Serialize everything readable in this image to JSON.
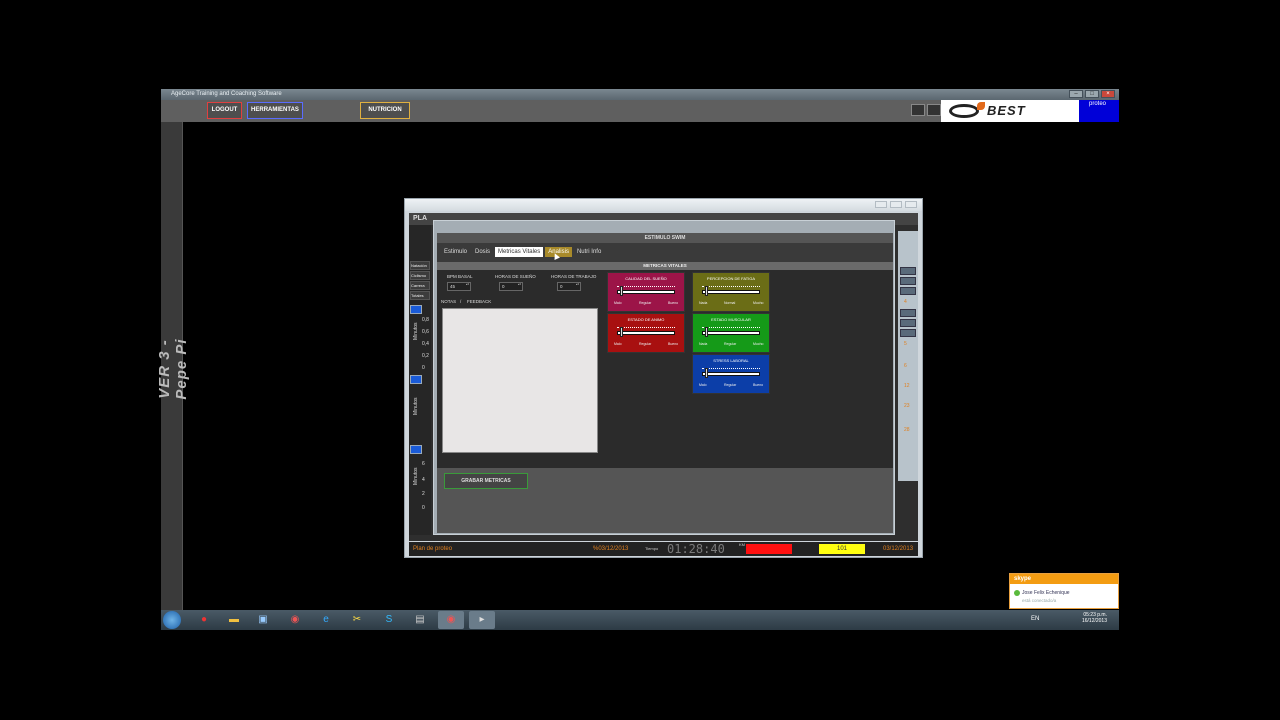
{
  "app": {
    "title": "AgeCore Training and Coaching Software",
    "toolbar": {
      "logout": "LOGOUT",
      "tools": "HERRAMIENTAS",
      "nutrition": "NUTRICION"
    },
    "logo": "BEST",
    "user": "proteo",
    "sidebar_text": "VER 3 - Pepe Pi"
  },
  "plan": {
    "head": "PLA",
    "left_items": [
      "Natación",
      "Ciclismo",
      "Carrera",
      "Totales"
    ],
    "left_vlabels": [
      "Minutos",
      "Minutos",
      "Minutos"
    ],
    "yticks": [
      "0,8",
      "0,6",
      "0,4",
      "0,2",
      "0",
      "6",
      "4",
      "2",
      "0"
    ],
    "right_nums": [
      "4",
      "5",
      "6",
      "12",
      "23",
      "28"
    ],
    "status": {
      "left": "Plan de proteo",
      "date1": "%03/12/2013",
      "time_label": "Tiempo",
      "time": "01:28:40",
      "km_label": "KM",
      "km_value": "101",
      "date2": "03/12/2013"
    }
  },
  "dialog": {
    "head": "ESTIMULO SWIM",
    "tabs": [
      "Estimulo",
      "Dosis",
      "Metricas Vitales",
      "Analisis",
      "Nutri Info"
    ],
    "active_tab": 2,
    "section_title": "METRICAS VITALES",
    "fields": {
      "bpm": {
        "label": "BPM BASAL",
        "value": "45"
      },
      "sleep": {
        "label": "HORAS DE SUEÑO",
        "value": "0"
      },
      "work": {
        "label": "HORAS DE TRABAJO",
        "value": "0"
      }
    },
    "notes_label": "NOTAS",
    "sep": "/",
    "feedback_label": "FEEDBACK",
    "gauges": [
      {
        "title": "CALIDAD DEL SUEÑO",
        "labels": [
          "Malo",
          "Regular",
          "Bueno"
        ],
        "color": "#9c1448",
        "level": 0.05
      },
      {
        "title": "PERCEPCION DE FATIGA",
        "labels": [
          "Nada",
          "Normal",
          "Mucho"
        ],
        "color": "#6b6d16",
        "level": 0.05
      },
      {
        "title": "ESTADO DE ANIMO",
        "labels": [
          "Malo",
          "Regular",
          "Bueno"
        ],
        "color": "#a81010",
        "level": 0.05
      },
      {
        "title": "ESTADO MUSCULAR",
        "labels": [
          "Nada",
          "Regular",
          "Mucho"
        ],
        "color": "#159a18",
        "level": 0.05
      },
      {
        "title": "STRESS LABORAL",
        "labels": [
          "Malo",
          "Regular",
          "Bueno"
        ],
        "color": "#0c3ea8",
        "level": 0.05
      }
    ],
    "save_button": "GRABAR METRICAS"
  },
  "taskbar": {
    "lang": "EN",
    "time": "05:23 p.m.",
    "date": "16/12/2013"
  },
  "notification": {
    "app": "skype",
    "name": "Jose Felix Echenique",
    "message": "está conectado/a"
  }
}
